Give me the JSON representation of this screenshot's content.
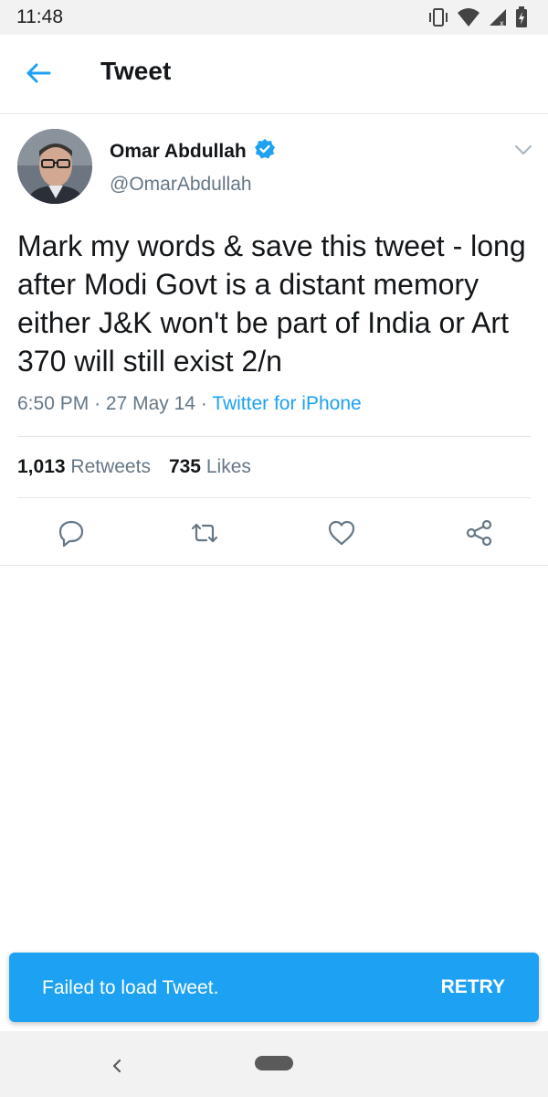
{
  "status_bar": {
    "time": "11:48",
    "icons": [
      "vibrate-icon",
      "wifi-icon",
      "signal-icon",
      "battery-icon"
    ]
  },
  "app_bar": {
    "title": "Tweet",
    "back_icon": "back-arrow-icon"
  },
  "tweet": {
    "author_name": "Omar Abdullah",
    "verified": true,
    "handle": "@OmarAbdullah",
    "text": "Mark my words & save this tweet - long after Modi Govt is a distant memory either J&K won't be part of India or Art 370 will still exist 2/n",
    "time": "6:50 PM",
    "separator": "·",
    "date": "27 May 14",
    "source": "Twitter for iPhone",
    "retweets_count": "1,013",
    "retweets_label": "Retweets",
    "likes_count": "735",
    "likes_label": "Likes",
    "actions": [
      "reply-icon",
      "retweet-icon",
      "like-icon",
      "share-icon"
    ]
  },
  "snackbar": {
    "message": "Failed to load Tweet.",
    "action": "RETRY"
  },
  "colors": {
    "accent": "#1da1f2",
    "secondary_text": "#657786",
    "primary_text": "#14171a"
  }
}
